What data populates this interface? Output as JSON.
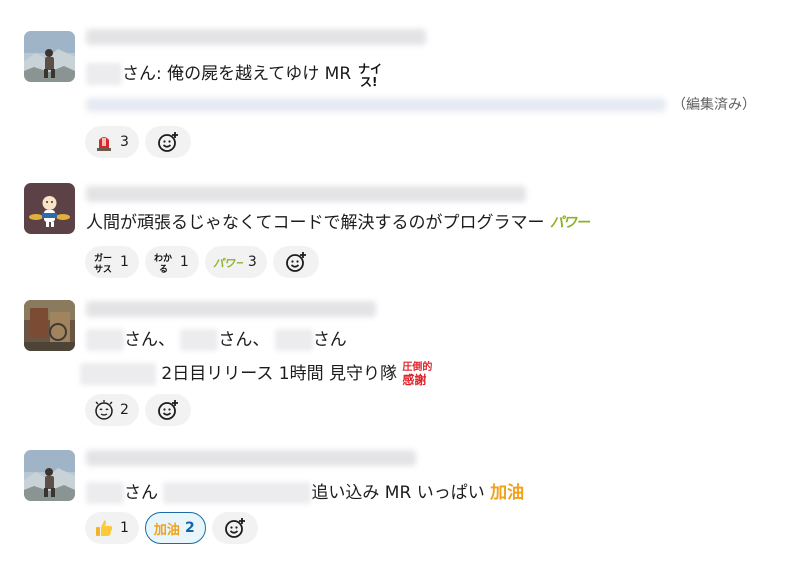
{
  "messages": [
    {
      "text_1": "さん: 俺の屍を越えてゆけ MR",
      "edited": "（編集済み）",
      "reactions": [
        {
          "emoji": "siren-icon",
          "count": "3"
        }
      ]
    },
    {
      "text_1": "人間が頑張るじゃなくてコードで解決するのがプログラマー",
      "text_emoji": "パワー",
      "reactions": [
        {
          "emoji": "gas-emoji",
          "label": "ガー\nサス",
          "count": "1"
        },
        {
          "emoji": "wakaru-emoji",
          "label": "わか\nる",
          "count": "1"
        },
        {
          "emoji": "power-emoji",
          "label": "パワー",
          "count": "3"
        }
      ]
    },
    {
      "line_1": [
        "さん、",
        "さん、",
        "さん"
      ],
      "line_2": "2日目リリース 1時間 見守り隊",
      "text_emoji_1": "圧倒的",
      "text_emoji_2": "感謝",
      "reactions": [
        {
          "emoji": "sparkle-face-icon",
          "count": "2"
        }
      ]
    },
    {
      "text_1": "さん",
      "text_2": "追い込み MR いっぱい",
      "text_emoji": "加油",
      "reactions": [
        {
          "emoji": "thumbsup-icon",
          "count": "1"
        },
        {
          "emoji": "jiayou-emoji",
          "label": "加油",
          "count": "2"
        }
      ]
    }
  ],
  "colors": {
    "reaction_bg": "#f2f2f3",
    "reaction_active_border": "#1d6ba6",
    "reaction_active_text": "#1264a3",
    "power_green": "#8db12a",
    "thanks_red": "#e0242a",
    "jiayou_orange": "#f2a21a"
  }
}
